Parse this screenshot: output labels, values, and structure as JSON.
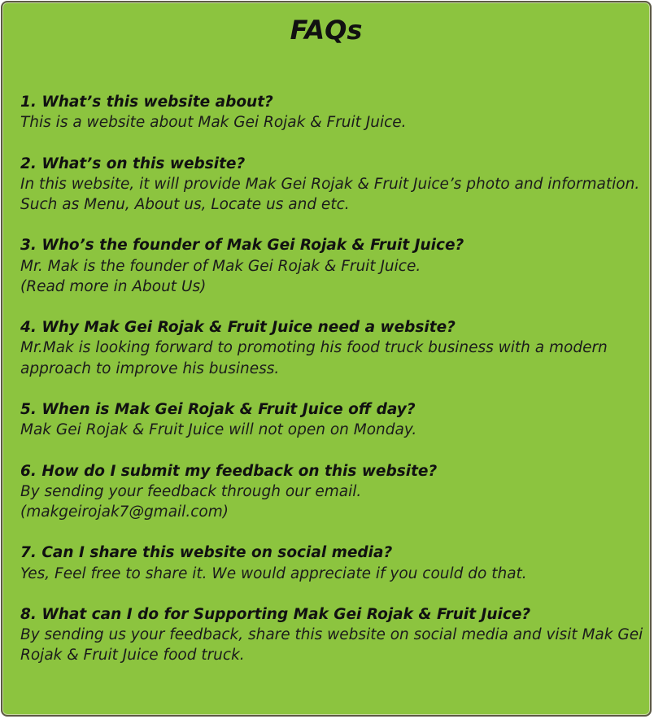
{
  "title": "FAQs",
  "faqs": [
    {
      "question": "1. What’s this website about?",
      "answer": [
        "This is a website about Mak Gei Rojak & Fruit Juice."
      ]
    },
    {
      "question": "2. What’s on this website?",
      "answer": [
        "In this website, it will provide Mak Gei Rojak & Fruit Juice’s photo and information.",
        "Such as Menu, About us, Locate us and etc."
      ]
    },
    {
      "question": "3. Who’s the founder of Mak Gei Rojak & Fruit Juice?",
      "answer": [
        "Mr. Mak is the founder of Mak Gei Rojak & Fruit Juice.",
        "(Read more in About Us)"
      ]
    },
    {
      "question": "4. Why Mak Gei Rojak & Fruit Juice need a website?",
      "answer": [
        "Mr.Mak is looking forward to promoting his food truck business with a modern",
        "approach to improve his business."
      ]
    },
    {
      "question": "5. When is Mak Gei Rojak & Fruit Juice off day?",
      "answer": [
        "Mak Gei Rojak & Fruit Juice will not open on Monday."
      ]
    },
    {
      "question": "6. How do I submit my feedback on this website?",
      "answer": [
        "By sending your feedback through our email.",
        "(makgeirojak7@gmail.com)"
      ]
    },
    {
      "question": "7. Can I share this website on social media?",
      "answer": [
        "Yes, Feel free to share it. We would appreciate if you could do that."
      ]
    },
    {
      "question": "8. What can I do for Supporting Mak Gei Rojak & Fruit Juice?",
      "answer": [
        "By sending us your feedback, share this website on social media and visit Mak Gei",
        "Rojak & Fruit Juice food truck."
      ]
    }
  ],
  "colors": {
    "panel_background": "#8cc43f",
    "panel_border": "#5d5a45",
    "text": "#111111"
  }
}
